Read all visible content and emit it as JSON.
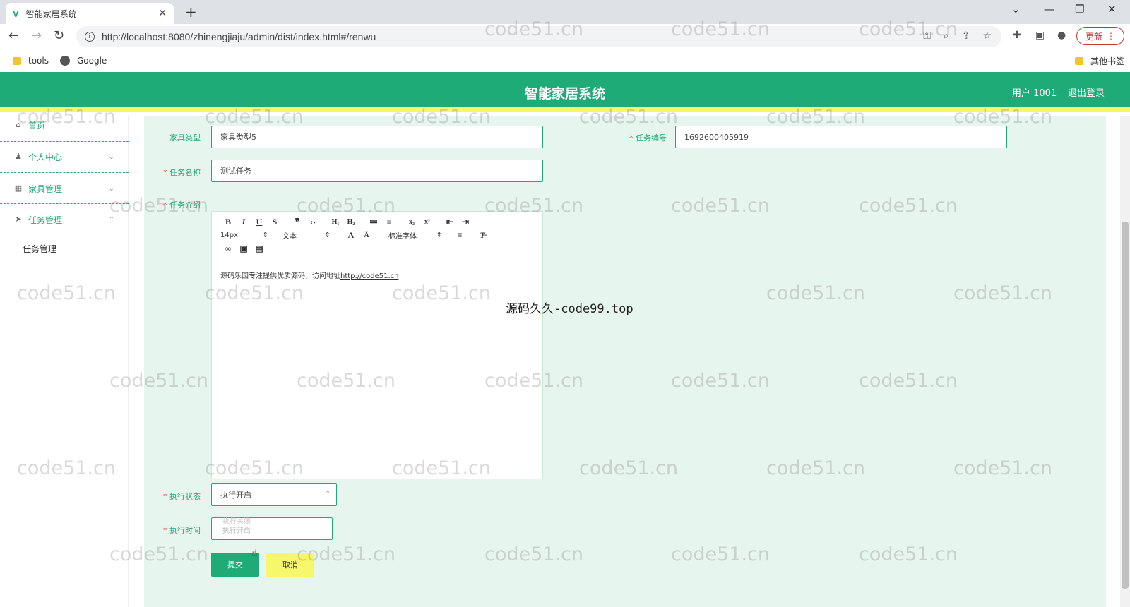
{
  "browser": {
    "tab_title": "智能家居系统",
    "url": "http://localhost:8080/zhinengjiaju/admin/dist/index.html#/renwu",
    "update_label": "更新",
    "bookmarks": [
      "tools",
      "Google"
    ],
    "other_bookmarks": "其他书签"
  },
  "header": {
    "title": "智能家居系统",
    "user": "用户 1001",
    "logout": "退出登录"
  },
  "sidebar": {
    "items": [
      {
        "label": "首页",
        "icon": "home-icon"
      },
      {
        "label": "个人中心",
        "icon": "user-icon"
      },
      {
        "label": "家具管理",
        "icon": "grid-icon"
      },
      {
        "label": "任务管理",
        "icon": "send-icon"
      }
    ],
    "submenu": "任务管理"
  },
  "form": {
    "furniture_type_label": "家具类型",
    "furniture_type_value": "家具类型5",
    "task_no_label": "任务编号",
    "task_no_value": "1692600405919",
    "task_name_label": "任务名称",
    "task_name_value": "测试任务",
    "intro_label": "任务介绍",
    "editor": {
      "font_size": "14px",
      "format": "文本",
      "font_family": "标准字体",
      "content_text": "源码乐园专注提供优质源码，访问地址",
      "content_link": "http://code51.cn"
    },
    "status_label": "执行状态",
    "status_value": "执行开启",
    "status_options": [
      "执行关闭",
      "执行开启"
    ],
    "time_label": "执行时间",
    "submit": "提交",
    "cancel": "取消"
  },
  "watermark": {
    "main": "code51.cn",
    "center": "源码久久-code99.top"
  }
}
